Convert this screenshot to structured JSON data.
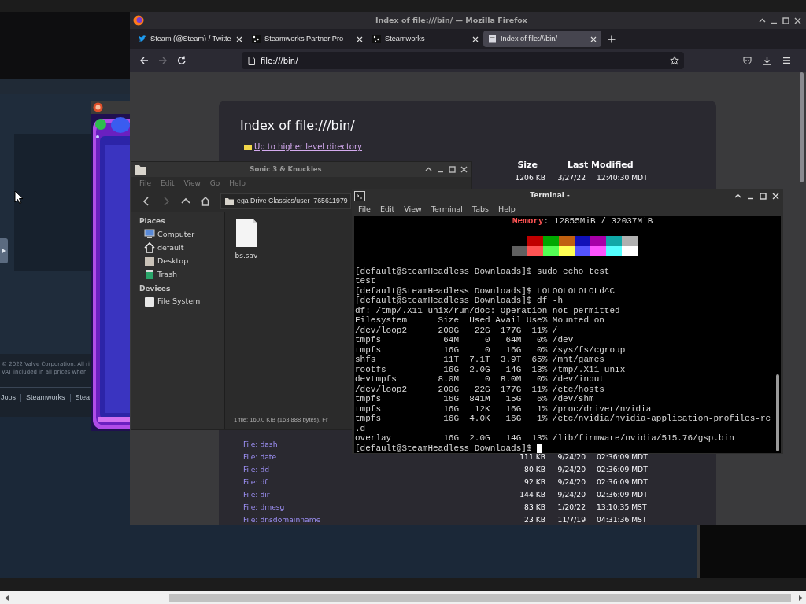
{
  "steam_page": {
    "footer_lines": [
      "© 2022 Valve Corporation. All ri",
      "VAT included in all prices wher"
    ],
    "footer_links": [
      "Jobs",
      "Steamworks",
      "Stea"
    ]
  },
  "browser": {
    "title": "Index of file:///bin/ — Mozilla Firefox",
    "tabs": [
      {
        "label": "Steam (@Steam) / Twitte",
        "kind": "bird",
        "selected": false
      },
      {
        "label": "Steamworks Partner Pro",
        "kind": "square",
        "selected": false
      },
      {
        "label": "Steamworks",
        "kind": "square",
        "selected": false
      },
      {
        "label": "Index of file:///bin/",
        "kind": "page",
        "selected": true
      }
    ],
    "nav": [
      {
        "kind": "back",
        "disabled": false
      },
      {
        "kind": "forward",
        "disabled": true
      },
      {
        "kind": "reload",
        "disabled": false
      }
    ],
    "url": "file:///bin/",
    "page": {
      "heading": "Index of file:///bin/",
      "up_link": "Up to higher level directory",
      "columns": [
        "Size",
        "Last Modified"
      ],
      "top_rows": [
        {
          "size": "1206 KB",
          "date": "3/27/22",
          "time": "12:40:30 MDT"
        }
      ],
      "bottom_rows": [
        {
          "name": "File: dash"
        },
        {
          "name": "File: date",
          "size": "111 KB",
          "date": "9/24/20",
          "time": "02:36:09 MDT"
        },
        {
          "name": "File: dd",
          "size": "80 KB",
          "date": "9/24/20",
          "time": "02:36:09 MDT"
        },
        {
          "name": "File: df",
          "size": "92 KB",
          "date": "9/24/20",
          "time": "02:36:09 MDT"
        },
        {
          "name": "File: dir",
          "size": "144 KB",
          "date": "9/24/20",
          "time": "02:36:09 MDT"
        },
        {
          "name": "File: dmesg",
          "size": "83 KB",
          "date": "1/20/22",
          "time": "13:10:35 MST"
        },
        {
          "name": "File: dnsdomainname",
          "size": "23 KB",
          "date": "11/7/19",
          "time": "04:31:36 MST"
        }
      ]
    }
  },
  "file_manager": {
    "title": "Sonic 3 & Knuckles",
    "menu": [
      "File",
      "Edit",
      "View",
      "Go",
      "Help"
    ],
    "toolbar": [
      {
        "kind": "back",
        "disabled": false
      },
      {
        "kind": "forward",
        "disabled": true
      },
      {
        "kind": "up",
        "disabled": false
      },
      {
        "kind": "home",
        "disabled": false
      }
    ],
    "path": "ega Drive Classics/user_765611979",
    "sidebar": [
      {
        "heading": "Places",
        "items": [
          {
            "label": "Computer",
            "kind": "computer"
          },
          {
            "label": "default",
            "kind": "home"
          },
          {
            "label": "Desktop",
            "kind": "desktop"
          },
          {
            "label": "Trash",
            "kind": "trash"
          }
        ]
      },
      {
        "heading": "Devices",
        "items": [
          {
            "label": "File System",
            "kind": "drive"
          }
        ]
      }
    ],
    "files": [
      {
        "name": "bs.sav"
      }
    ],
    "status": "1 file: 160.0 KiB (163,888 bytes), Fr"
  },
  "terminal": {
    "title": "Terminal -",
    "menu": [
      "File",
      "Edit",
      "View",
      "Terminal",
      "Tabs",
      "Help"
    ],
    "memory": {
      "label": "Memory",
      "value": ": 12855MiB / 32037MiB"
    },
    "palette": [
      {
        "swatches": [
          {
            "color": "#c00000"
          },
          {
            "color": "#00a800"
          },
          {
            "color": "#c06010"
          },
          {
            "color": "#1010b8"
          },
          {
            "color": "#a800a8"
          },
          {
            "color": "#10a8a8"
          },
          {
            "color": "#b0b0b0"
          }
        ]
      },
      {
        "swatches": [
          {
            "color": "#606060"
          },
          {
            "color": "#ff5454"
          },
          {
            "color": "#54ff54"
          },
          {
            "color": "#ffff54"
          },
          {
            "color": "#5454ff"
          },
          {
            "color": "#ff54ff"
          },
          {
            "color": "#54ffff"
          },
          {
            "color": "#ffffff"
          }
        ]
      }
    ],
    "lines": [
      "[default@SteamHeadless Downloads]$ sudo echo test",
      "test",
      "[default@SteamHeadless Downloads]$ LOLOOLOLOLOLd^C",
      "[default@SteamHeadless Downloads]$ df -h",
      "df: /tmp/.X11-unix/run/doc: Operation not permitted",
      "Filesystem      Size  Used Avail Use% Mounted on",
      "/dev/loop2      200G   22G  177G  11% /",
      "tmpfs            64M     0   64M   0% /dev",
      "tmpfs            16G     0   16G   0% /sys/fs/cgroup",
      "shfs             11T  7.1T  3.9T  65% /mnt/games",
      "rootfs           16G  2.0G   14G  13% /tmp/.X11-unix",
      "devtmpfs        8.0M     0  8.0M   0% /dev/input",
      "/dev/loop2      200G   22G  177G  11% /etc/hosts",
      "tmpfs            16G  841M   15G   6% /dev/shm",
      "tmpfs            16G   12K   16G   1% /proc/driver/nvidia",
      "tmpfs            16G  4.0K   16G   1% /etc/nvidia/nvidia-application-profiles-rc",
      ".d",
      "overlay          16G  2.0G   14G  13% /lib/firmware/nvidia/515.76/gsp.bin",
      "[default@SteamHeadless Downloads]$"
    ],
    "cursor": true
  }
}
